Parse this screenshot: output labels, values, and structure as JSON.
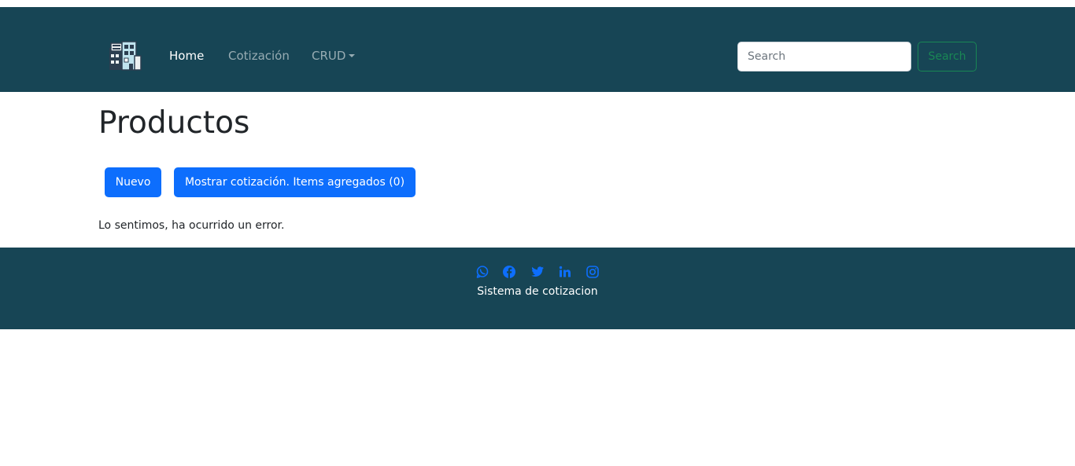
{
  "navbar": {
    "logo_icon": "building-house-icon",
    "links": [
      {
        "label": "Home",
        "active": true
      },
      {
        "label": "Cotización",
        "active": false
      },
      {
        "label": "CRUD",
        "active": false,
        "dropdown": true
      }
    ],
    "search": {
      "placeholder": "Search",
      "value": "",
      "button_label": "Search"
    }
  },
  "main": {
    "title": "Productos",
    "buttons": {
      "nuevo": "Nuevo",
      "mostrar": "Mostrar cotización. Items agregados (0)"
    },
    "error_message": "Lo sentimos, ha ocurrido un error."
  },
  "footer": {
    "social_icons": [
      "whatsapp-icon",
      "facebook-icon",
      "twitter-icon",
      "linkedin-icon",
      "instagram-icon"
    ],
    "text": "Sistema de cotizacion"
  },
  "colors": {
    "navbar_bg": "#174555",
    "primary": "#0d6efd",
    "success": "#198754"
  }
}
